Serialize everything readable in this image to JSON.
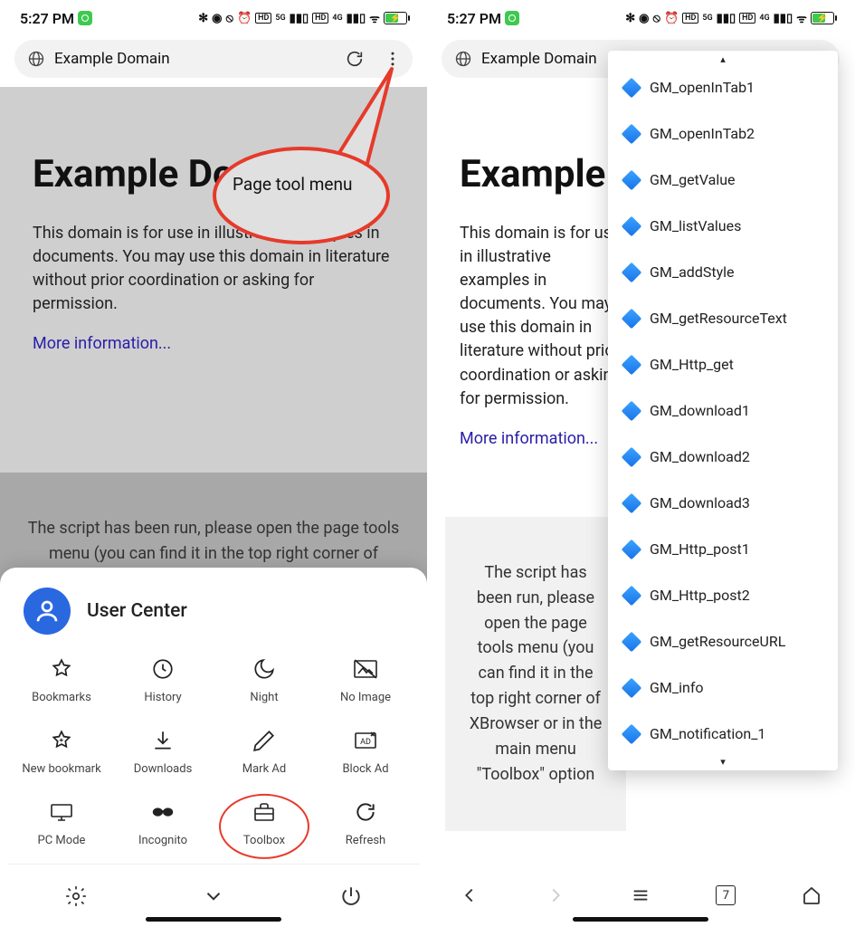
{
  "status": {
    "time": "5:27 PM",
    "net1": "5G",
    "net2": "4G",
    "hd1": "HD",
    "hd2": "HD"
  },
  "addressbar": {
    "title": "Example Domain"
  },
  "page": {
    "heading_left": "Example Do",
    "heading_right": "Example",
    "paragraph": "This domain is for use in illustrative examples in documents. You may use this domain in literature without prior coordination or asking for permission.",
    "paragraph_right": "This domain is for use in illustrative examples in documents. You may use this domain in literature without prior coordination or asking for permission.",
    "link": "More information...",
    "notice": "The script has been run, please open the page tools menu (you can find it in the top right corner of XBrowser or in the main menu \"Toolbox\" option) to start running test entries",
    "notice_right": "The script has been run, please open the page tools menu (you can find it in the top right corner of XBrowser or in the main menu \"Toolbox\" option"
  },
  "callout": "Page tool menu",
  "sheet": {
    "title": "User Center",
    "items": [
      "Bookmarks",
      "History",
      "Night",
      "No Image",
      "New bookmark",
      "Downloads",
      "Mark Ad",
      "Block Ad",
      "PC Mode",
      "Incognito",
      "Toolbox",
      "Refresh"
    ]
  },
  "dropdown": {
    "items": [
      "GM_openInTab1",
      "GM_openInTab2",
      "GM_getValue",
      "GM_listValues",
      "GM_addStyle",
      "GM_getResourceText",
      "GM_Http_get",
      "GM_download1",
      "GM_download2",
      "GM_download3",
      "GM_Http_post1",
      "GM_Http_post2",
      "GM_getResourceURL",
      "GM_info",
      "GM_notification_1"
    ]
  },
  "tabs": {
    "count": "7"
  }
}
